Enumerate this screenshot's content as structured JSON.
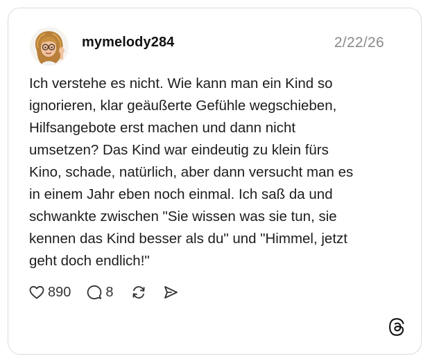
{
  "post": {
    "username": "mymelody284",
    "date": "2/22/26",
    "text": "Ich verstehe es nicht. Wie kann man ein Kind so\nignorieren, klar geäußerte Gefühle wegschieben,\nHilfsangebote erst machen und dann nicht\numsetzen? Das Kind war eindeutig zu klein fürs\nKino, schade, natürlich, aber dann versucht man es\nin einem Jahr eben noch einmal. Ich saß da und\nschwankte zwischen \"Sie wissen was sie tun, sie\nkennen das Kind besser als du\" und \"Himmel, jetzt\ngeht doch endlich!\"",
    "avatar_icon": "memoji-avatar",
    "actions": {
      "like_count": "890",
      "reply_count": "8",
      "like_icon": "heart-icon",
      "reply_icon": "comment-icon",
      "repost_icon": "repost-icon",
      "share_icon": "send-icon"
    },
    "brand_icon": "threads-logo-icon"
  }
}
